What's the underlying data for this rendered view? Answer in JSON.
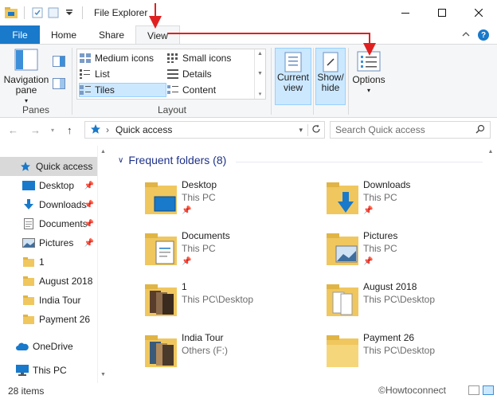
{
  "window": {
    "title": "File Explorer"
  },
  "ribbon_tabs": {
    "file": "File",
    "home": "Home",
    "share": "Share",
    "view": "View"
  },
  "ribbon": {
    "panes": {
      "navigation_pane": "Navigation pane",
      "label": "Panes"
    },
    "layout": {
      "medium_icons": "Medium icons",
      "small_icons": "Small icons",
      "list": "List",
      "details": "Details",
      "tiles": "Tiles",
      "content": "Content",
      "label": "Layout",
      "selected": "Tiles"
    },
    "current_view": "Current view",
    "show_hide": "Show/ hide",
    "options": "Options"
  },
  "address": {
    "path": "Quick access",
    "search_placeholder": "Search Quick access"
  },
  "nav_pane": {
    "items": [
      {
        "label": "Quick access",
        "icon": "star-icon",
        "pinned": false,
        "selected": true
      },
      {
        "label": "Desktop",
        "icon": "desktop-icon",
        "pinned": true
      },
      {
        "label": "Downloads",
        "icon": "download-icon",
        "pinned": true
      },
      {
        "label": "Documents",
        "icon": "document-icon",
        "pinned": true
      },
      {
        "label": "Pictures",
        "icon": "pictures-icon",
        "pinned": true
      },
      {
        "label": "1",
        "icon": "folder-icon",
        "pinned": false
      },
      {
        "label": "August 2018",
        "icon": "folder-icon",
        "pinned": false
      },
      {
        "label": "India Tour",
        "icon": "folder-icon",
        "pinned": false
      },
      {
        "label": "Payment 26",
        "icon": "folder-icon",
        "pinned": false
      },
      {
        "label": "OneDrive",
        "icon": "cloud-icon",
        "pinned": false
      },
      {
        "label": "This PC",
        "icon": "computer-icon",
        "pinned": false
      }
    ]
  },
  "content": {
    "section_title": "Frequent folders (8)",
    "folders": [
      {
        "name": "Desktop",
        "location": "This PC",
        "pinned": true,
        "icon": "desktop-folder-icon"
      },
      {
        "name": "Downloads",
        "location": "This PC",
        "pinned": true,
        "icon": "downloads-folder-icon"
      },
      {
        "name": "Documents",
        "location": "This PC",
        "pinned": true,
        "icon": "documents-folder-icon"
      },
      {
        "name": "Pictures",
        "location": "This PC",
        "pinned": true,
        "icon": "pictures-folder-icon"
      },
      {
        "name": "1",
        "location": "This PC\\Desktop",
        "pinned": false,
        "icon": "photo-folder-icon"
      },
      {
        "name": "August 2018",
        "location": "This PC\\Desktop",
        "pinned": false,
        "icon": "document-folder-icon"
      },
      {
        "name": "India Tour",
        "location": "Others (F:)",
        "pinned": false,
        "icon": "photo-folder-icon"
      },
      {
        "name": "Payment 26",
        "location": "This PC\\Desktop",
        "pinned": false,
        "icon": "folder-icon"
      }
    ]
  },
  "status": {
    "item_count": "28 items"
  },
  "watermark": "©Howtoconnect",
  "colors": {
    "accent": "#1979ca",
    "folder": "#f0c75e",
    "arrow": "#e02020",
    "section_title": "#1e3287"
  }
}
